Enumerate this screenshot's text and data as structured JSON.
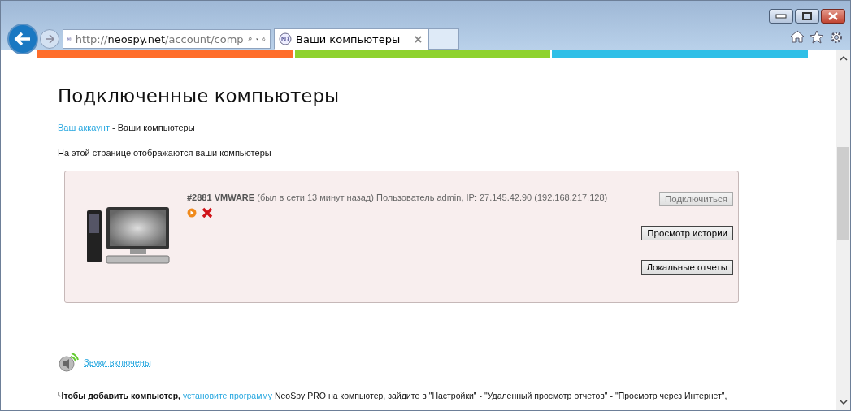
{
  "browser": {
    "address": {
      "scheme": "http://",
      "host": "neospy.net",
      "path": "/account/comp"
    },
    "tab": {
      "title": "Ваши компьютеры",
      "selected": true
    }
  },
  "page": {
    "heading": "Подключенные компьютеры",
    "breadcrumb": {
      "link": "Ваш аккаунт",
      "rest": " - Ваши компьютеры"
    },
    "intro": "На этой странице отображаются ваши компьютеры",
    "computers": [
      {
        "id": "#2881",
        "name": "VMWARE",
        "info": "(был в сети 13 минут назад) Пользователь admin, IP: 27.145.42.90 (192.168.217.128)",
        "buttons": [
          {
            "label": "Подключиться",
            "disabled": true
          },
          {
            "label": "Просмотр истории",
            "disabled": false
          },
          {
            "label": "Локальные отчеты",
            "disabled": false
          }
        ]
      }
    ],
    "sound": {
      "label": "Звуки включены",
      "on": true
    },
    "instructions": {
      "lead": "Чтобы добавить компьютер,",
      "link": "установите программу",
      "rest": " NeoSpy PRO на компьютер, зайдите в \"Настройки\" - \"Удаленный просмотр отчетов\" - \"Просмотр через Интернет\","
    }
  }
}
